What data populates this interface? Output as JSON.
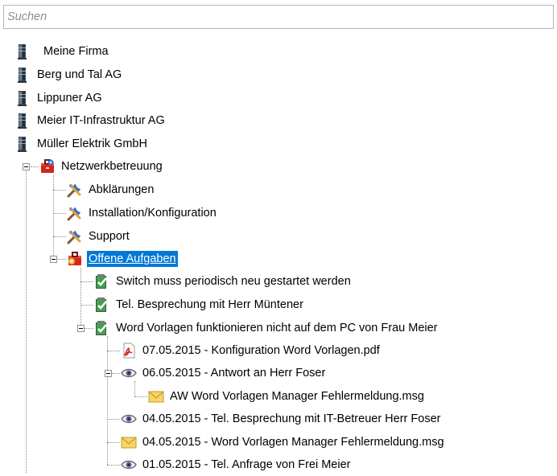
{
  "search": {
    "placeholder": "Suchen"
  },
  "tree": {
    "customers": [
      {
        "label": "Meine Firma",
        "icon": "server-icon"
      },
      {
        "label": "Berg und Tal AG",
        "icon": "server-icon"
      },
      {
        "label": "Lippuner AG",
        "icon": "server-icon"
      },
      {
        "label": "Meier IT-Infrastruktur AG",
        "icon": "server-icon"
      },
      {
        "label": "Müller Elektrik GmbH",
        "icon": "server-icon"
      }
    ],
    "contract": {
      "label": "Netzwerkbetreuung",
      "icon": "toolbox-icon",
      "expanded": true
    },
    "categories": [
      {
        "label": "Abklärungen",
        "icon": "tools-icon"
      },
      {
        "label": "Installation/Konfiguration",
        "icon": "tools-icon"
      },
      {
        "label": "Support",
        "icon": "tools-icon"
      }
    ],
    "open_tasks": {
      "label": "Offene Aufgaben",
      "icon": "open-tasks-icon",
      "selected": true,
      "expanded": true
    },
    "tasks": [
      {
        "label": "Switch muss periodisch neu gestartet werden",
        "icon": "task-icon"
      },
      {
        "label": "Tel. Besprechung mit Herr Müntener",
        "icon": "task-icon"
      },
      {
        "label": "Word Vorlagen funktionieren nicht auf dem PC von Frau Meier",
        "icon": "task-icon",
        "expanded": true
      }
    ],
    "documents": [
      {
        "label": "07.05.2015 - Konfiguration Word Vorlagen.pdf",
        "icon": "pdf-icon"
      },
      {
        "label": "06.05.2015 - Antwort an Herr Foser",
        "icon": "eye-icon",
        "expanded": true
      },
      {
        "label": "AW  Word Vorlagen Manager Fehlermeldung.msg",
        "icon": "envelope-icon"
      },
      {
        "label": "04.05.2015 - Tel. Besprechung mit IT-Betreuer Herr Foser",
        "icon": "eye-icon"
      },
      {
        "label": "04.05.2015 - Word Vorlagen Manager Fehlermeldung.msg",
        "icon": "envelope-icon"
      },
      {
        "label": "01.05.2015 - Tel. Anfrage von Frei Meier",
        "icon": "eye-icon"
      }
    ]
  },
  "colors": {
    "selection": "#0078d7",
    "tree_lines": "#8a8a8a",
    "search_border": "#adb5be",
    "placeholder": "#8c8c8c"
  }
}
